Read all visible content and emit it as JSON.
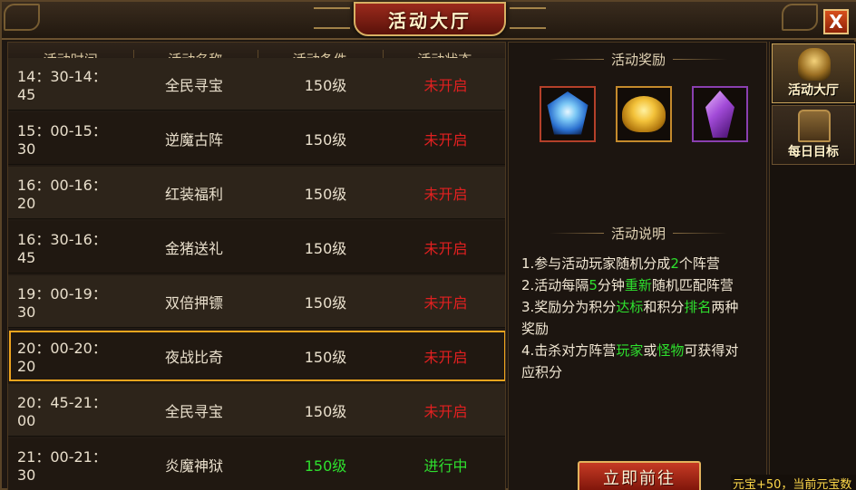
{
  "window": {
    "title": "活动大厅",
    "close_label": "X"
  },
  "table": {
    "headers": [
      "活动时间",
      "活动名称",
      "活动条件",
      "活动状态"
    ],
    "rows": [
      {
        "time": "14：30-14：45",
        "name": "全民寻宝",
        "condition": "150级",
        "status": "未开启",
        "active": false
      },
      {
        "time": "15：00-15：30",
        "name": "逆魔古阵",
        "condition": "150级",
        "status": "未开启",
        "active": false
      },
      {
        "time": "16：00-16：20",
        "name": "红装福利",
        "condition": "150级",
        "status": "未开启",
        "active": false
      },
      {
        "time": "16：30-16：45",
        "name": "金猪送礼",
        "condition": "150级",
        "status": "未开启",
        "active": false
      },
      {
        "time": "19：00-19：30",
        "name": "双倍押镖",
        "condition": "150级",
        "status": "未开启",
        "active": false
      },
      {
        "time": "20：00-20：20",
        "name": "夜战比奇",
        "condition": "150级",
        "status": "未开启",
        "active": false,
        "selected": true
      },
      {
        "time": "20：45-21：00",
        "name": "全民寻宝",
        "condition": "150级",
        "status": "未开启",
        "active": false
      },
      {
        "time": "21：00-21：30",
        "name": "炎魔神狱",
        "condition": "150级",
        "status": "进行中",
        "active": true
      }
    ]
  },
  "rewards": {
    "title": "活动奖励",
    "items": [
      {
        "icon": "blue-crystal-icon"
      },
      {
        "icon": "gold-ingot-icon"
      },
      {
        "icon": "purple-crystal-icon"
      }
    ]
  },
  "description": {
    "title": "活动说明",
    "lines": [
      {
        "parts": [
          {
            "t": "1.参与活动玩家随机分成"
          },
          {
            "t": "2",
            "c": "green"
          },
          {
            "t": "个阵营"
          }
        ]
      },
      {
        "parts": [
          {
            "t": "2.活动每隔"
          },
          {
            "t": "5",
            "c": "green"
          },
          {
            "t": "分钟"
          },
          {
            "t": "重新",
            "c": "green"
          },
          {
            "t": "随机匹配阵营"
          }
        ]
      },
      {
        "parts": [
          {
            "t": "3.奖励分为积分"
          },
          {
            "t": "达标",
            "c": "green"
          },
          {
            "t": "和积分"
          },
          {
            "t": "排名",
            "c": "green"
          },
          {
            "t": "两种"
          }
        ]
      },
      {
        "parts": [
          {
            "t": "奖励"
          }
        ]
      },
      {
        "parts": [
          {
            "t": "4.击杀对方阵营"
          },
          {
            "t": "玩家",
            "c": "green"
          },
          {
            "t": "或"
          },
          {
            "t": "怪物",
            "c": "green"
          },
          {
            "t": "可获得对"
          }
        ]
      },
      {
        "parts": [
          {
            "t": "应积分"
          }
        ]
      }
    ]
  },
  "go_button": "立即前往",
  "side_tabs": [
    {
      "label": "活动大厅",
      "icon": "helmet-icon",
      "active": true
    },
    {
      "label": "每日目标",
      "icon": "treasure-chest-icon",
      "active": false
    }
  ],
  "notice": "元宝+50，当前元宝数",
  "colors": {
    "inactive_status": "#e02020",
    "active_status": "#2ee02e",
    "selection": "#f0a51e"
  }
}
